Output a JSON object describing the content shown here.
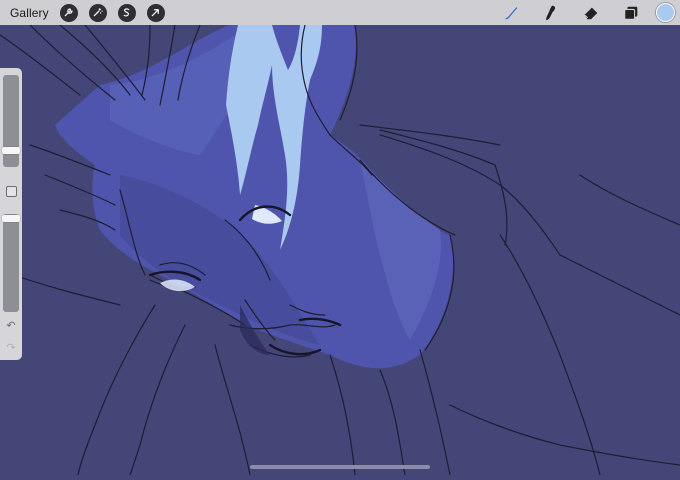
{
  "toolbar": {
    "gallery_label": "Gallery",
    "left_tools": [
      {
        "icon": "wrench-icon",
        "name": "actions"
      },
      {
        "icon": "magic-wand-icon",
        "name": "adjustments"
      },
      {
        "icon": "selection-icon",
        "name": "selection"
      },
      {
        "icon": "arrow-cursor-icon",
        "name": "transform"
      }
    ],
    "right_tools": [
      {
        "icon": "brush-icon",
        "name": "brush",
        "active": true
      },
      {
        "icon": "smudge-icon",
        "name": "smudge"
      },
      {
        "icon": "eraser-icon",
        "name": "eraser"
      },
      {
        "icon": "layers-icon",
        "name": "layers"
      }
    ],
    "active_color": "#a9c9f1",
    "active_tool_color": "#2f6bd8"
  },
  "sidebar": {
    "brush_size_level": 0.2,
    "opacity_level": 1.0
  },
  "canvas": {
    "background_color": "#434677",
    "skin_color": "#4f55ad",
    "highlight_color": "#a9c9f1",
    "line_color": "#1f1d35"
  }
}
